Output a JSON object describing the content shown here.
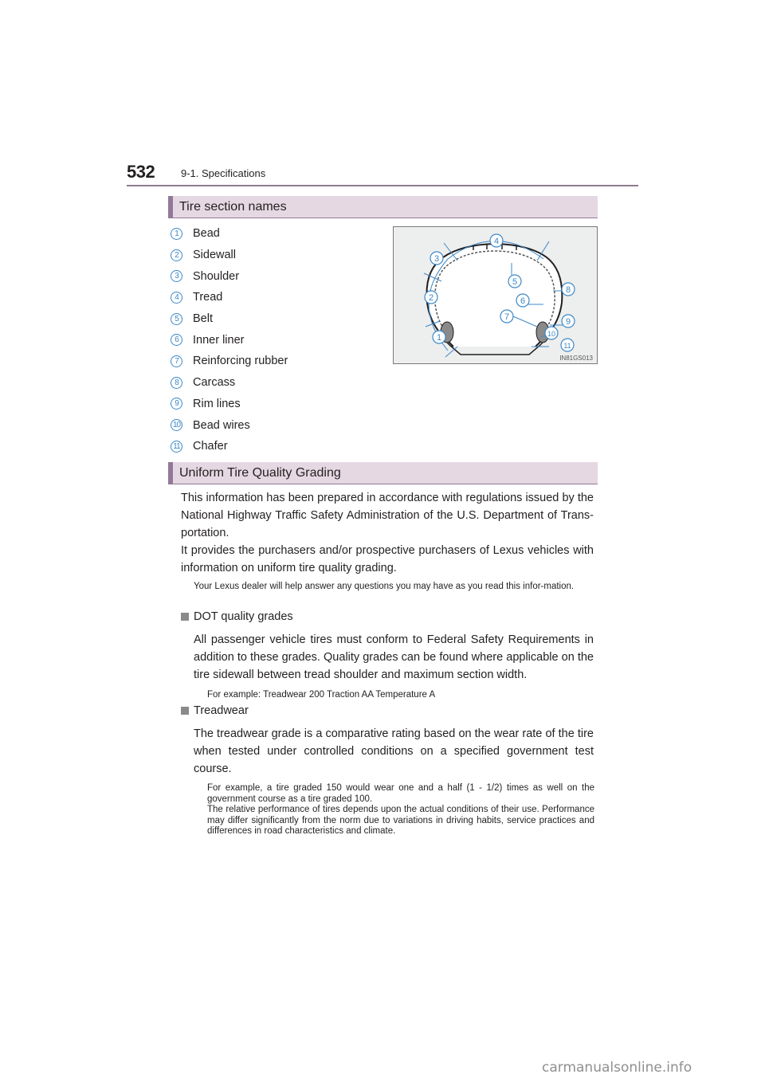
{
  "header": {
    "page_number": "532",
    "section_ref": "9-1. Specifications"
  },
  "tire_section": {
    "heading": "Tire section names",
    "items": [
      {
        "number": "1",
        "label": "Bead"
      },
      {
        "number": "2",
        "label": "Sidewall"
      },
      {
        "number": "3",
        "label": "Shoulder"
      },
      {
        "number": "4",
        "label": "Tread"
      },
      {
        "number": "5",
        "label": "Belt"
      },
      {
        "number": "6",
        "label": "Inner liner"
      },
      {
        "number": "7",
        "label": "Reinforcing rubber"
      },
      {
        "number": "8",
        "label": "Carcass"
      },
      {
        "number": "9",
        "label": "Rim lines"
      },
      {
        "number": "10",
        "label": "Bead wires"
      },
      {
        "number": "11",
        "label": "Chafer"
      }
    ],
    "diagram": {
      "code": "IN81GS013",
      "callouts": [
        "1",
        "2",
        "3",
        "4",
        "5",
        "6",
        "7",
        "8",
        "9",
        "10",
        "11"
      ]
    }
  },
  "utqg_section": {
    "heading": "Uniform Tire Quality Grading",
    "intro_1": "This information has been prepared in accordance with regulations issued by the National Highway Traffic Safety Administration of the U.S. Department of Trans-portation.",
    "intro_2": "It provides the purchasers and/or prospective purchasers of Lexus vehicles with information on uniform tire quality grading.",
    "note": "Your Lexus dealer will help answer any questions you may have as you read this infor-mation.",
    "dot": {
      "heading": "DOT quality grades",
      "text": "All passenger vehicle tires must conform to Federal Safety Requirements in addition to these grades. Quality grades can be found where applicable on the tire sidewall between tread shoulder and maximum section width.",
      "example": "For example: Treadwear 200 Traction AA Temperature A"
    },
    "treadwear": {
      "heading": "Treadwear",
      "text": "The treadwear grade is a comparative rating based on the wear rate of the tire when tested under controlled conditions on a specified government test course.",
      "note_1": "For example, a tire graded 150 would wear one and a half (1 - 1/2) times as well on the government course as a tire graded 100.",
      "note_2": "The relative performance of tires depends upon the actual conditions of their use. Performance may differ significantly from the norm due to variations in driving habits, service practices and differences in road characteristics and climate."
    }
  },
  "watermark": "carmanualsonline.info",
  "colors": {
    "accent_purple": "#93789a",
    "heading_bg": "#e5d8e2",
    "callout_blue": "#3c88c7"
  }
}
